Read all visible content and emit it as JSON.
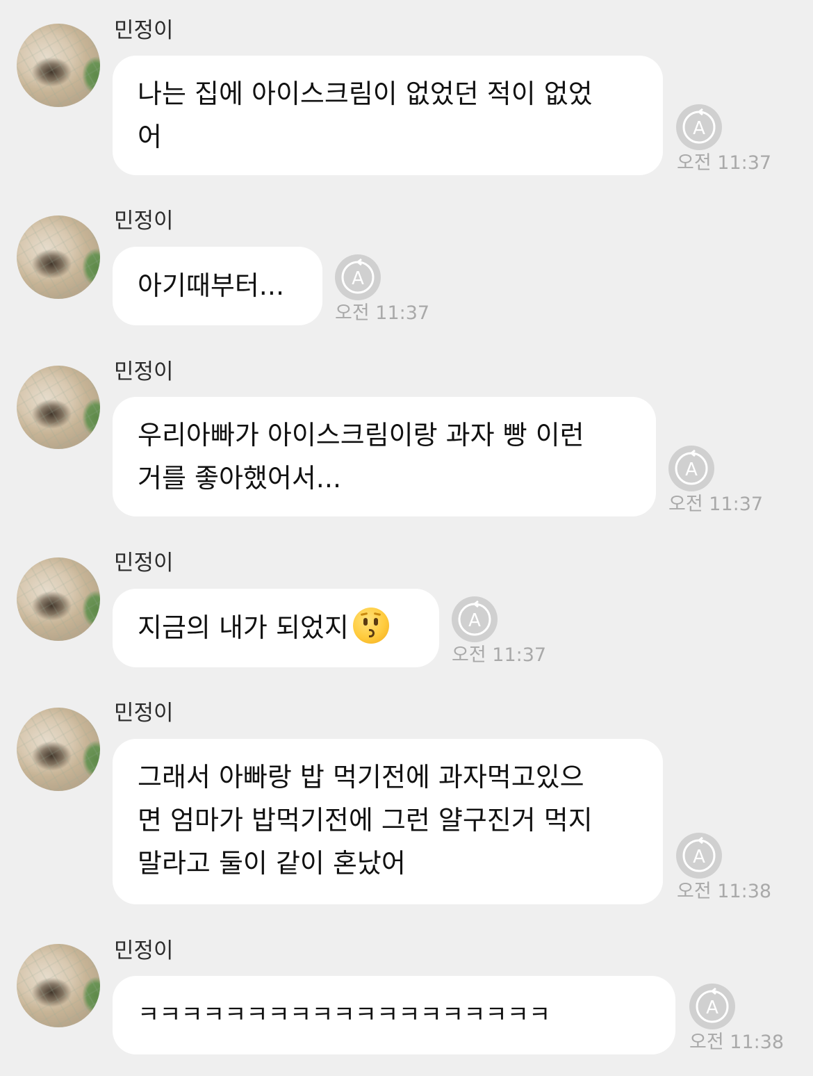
{
  "colors": {
    "background": "#efefef",
    "bubble": "#ffffff",
    "timestamp": "#a9a9a9",
    "translate_button": "#d0d0d0"
  },
  "messages": [
    {
      "sender": "민정이",
      "lines": [
        "나는 집에 아이스크림이 없었던 적이 없었",
        "어"
      ],
      "time": "오전 11:37"
    },
    {
      "sender": "민정이",
      "lines": [
        "아기때부터..."
      ],
      "time": "오전 11:37"
    },
    {
      "sender": "민정이",
      "lines": [
        "우리아빠가 아이스크림이랑 과자 빵 이런",
        "거를 좋아했어서..."
      ],
      "time": "오전 11:37"
    },
    {
      "sender": "민정이",
      "lines": [
        "지금의 내가 되었지"
      ],
      "emoji": "kissing-face-emoji",
      "time": "오전 11:37"
    },
    {
      "sender": "민정이",
      "lines": [
        "그래서 아빠랑 밥 먹기전에 과자먹고있으",
        "면 엄마가 밥먹기전에 그런 얄구진거 먹지",
        "말라고 둘이 같이 혼났어"
      ],
      "time": "오전 11:38"
    },
    {
      "sender": "민정이",
      "lines": [
        "ㅋㅋㅋㅋㅋㅋㅋㅋㅋㅋㅋㅋㅋㅋㅋㅋㅋㅋㅋ"
      ],
      "time": "오전 11:38"
    }
  ],
  "icons": {
    "avatar": "profile-photo-dog",
    "translate": "translate-icon"
  }
}
